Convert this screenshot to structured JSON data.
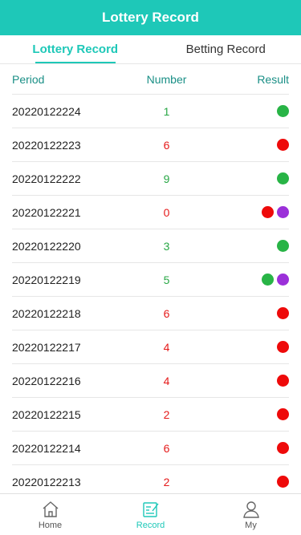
{
  "header": {
    "title": "Lottery Record"
  },
  "tabs": [
    {
      "label": "Lottery Record",
      "active": true
    },
    {
      "label": "Betting Record",
      "active": false
    }
  ],
  "table": {
    "columns": {
      "period": "Period",
      "number": "Number",
      "result": "Result"
    },
    "rows": [
      {
        "period": "20220122224",
        "number": "1",
        "number_color": "green",
        "results": [
          "green"
        ]
      },
      {
        "period": "20220122223",
        "number": "6",
        "number_color": "red",
        "results": [
          "red"
        ]
      },
      {
        "period": "20220122222",
        "number": "9",
        "number_color": "green",
        "results": [
          "green"
        ]
      },
      {
        "period": "20220122221",
        "number": "0",
        "number_color": "red",
        "results": [
          "red",
          "violet"
        ]
      },
      {
        "period": "20220122220",
        "number": "3",
        "number_color": "green",
        "results": [
          "green"
        ]
      },
      {
        "period": "20220122219",
        "number": "5",
        "number_color": "green",
        "results": [
          "green",
          "violet"
        ]
      },
      {
        "period": "20220122218",
        "number": "6",
        "number_color": "red",
        "results": [
          "red"
        ]
      },
      {
        "period": "20220122217",
        "number": "4",
        "number_color": "red",
        "results": [
          "red"
        ]
      },
      {
        "period": "20220122216",
        "number": "4",
        "number_color": "red",
        "results": [
          "red"
        ]
      },
      {
        "period": "20220122215",
        "number": "2",
        "number_color": "red",
        "results": [
          "red"
        ]
      },
      {
        "period": "20220122214",
        "number": "6",
        "number_color": "red",
        "results": [
          "red"
        ]
      },
      {
        "period": "20220122213",
        "number": "2",
        "number_color": "red",
        "results": [
          "red"
        ]
      }
    ]
  },
  "colors": {
    "accent": "#1ec8b8",
    "green": "#28b446",
    "red": "#ee0a0a",
    "violet": "#9b30d9"
  },
  "bottom_nav": [
    {
      "label": "Home",
      "icon": "home-icon",
      "active": false
    },
    {
      "label": "Record",
      "icon": "record-icon",
      "active": true
    },
    {
      "label": "My",
      "icon": "user-icon",
      "active": false
    }
  ]
}
